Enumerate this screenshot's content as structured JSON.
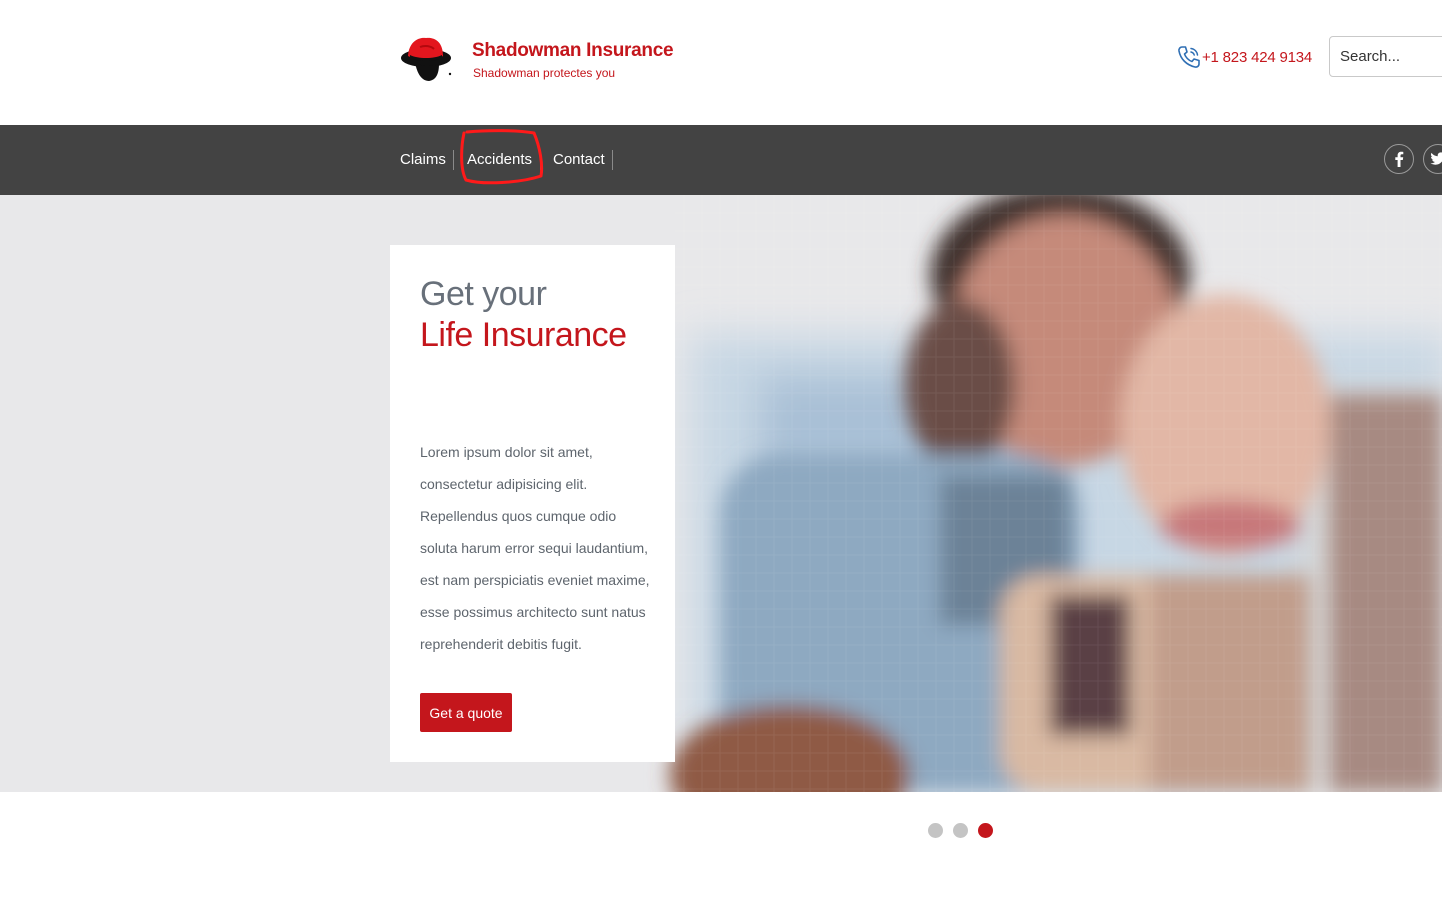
{
  "header": {
    "brand_name": "Shadowman Insurance",
    "tagline": "Shadowman protectes you",
    "phone": "+1 823 424 9134",
    "search_placeholder": "Search..."
  },
  "nav": {
    "items": [
      {
        "label": "Claims",
        "highlighted": false
      },
      {
        "label": "Accidents",
        "highlighted": true
      },
      {
        "label": "Contact",
        "highlighted": false
      }
    ],
    "social": [
      "facebook-icon",
      "twitter-icon"
    ]
  },
  "hero": {
    "heading_line1": "Get your",
    "heading_line2": "Life Insurance",
    "body": "Lorem ipsum dolor sit amet, consectetur adipisicing elit. Repellendus quos cumque odio soluta harum error sequi laudantium, est nam perspiciatis eveniet maxime, esse possimus architecto sunt natus reprehenderit debitis fugit.",
    "cta_label": "Get a quote",
    "image": "pixelated photo of a smiling couple"
  },
  "carousel": {
    "slide_count": 3,
    "active_index": 2
  },
  "colors": {
    "brand_red": "#c4161c",
    "nav_background": "#434343",
    "heading_gray": "#68707a",
    "dot_inactive": "#c4c4c4",
    "annotation_red": "#ff1a1a"
  }
}
